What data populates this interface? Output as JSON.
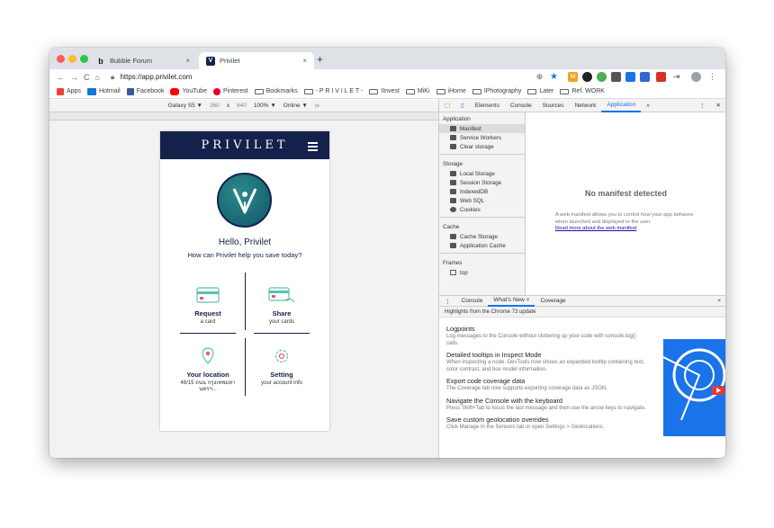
{
  "browser": {
    "tabs": [
      {
        "title": "Bubble Forum",
        "favicon": "bubble-b",
        "active": false
      },
      {
        "title": "Privilet",
        "favicon": "V",
        "active": true
      }
    ],
    "new_tab": "+",
    "close": "×",
    "url": "https://app.privilet.com",
    "nav_icons": [
      "back-arrow-icon",
      "forward-arrow-icon",
      "reload-icon",
      "home-icon"
    ]
  },
  "bookmarks": [
    {
      "label": "Apps",
      "icon": "apps-grid",
      "color": "#ea4335"
    },
    {
      "label": "Hotmail",
      "icon": "outlook",
      "color": "#0f78d4"
    },
    {
      "label": "Facebook",
      "icon": "facebook",
      "color": "#3b5998"
    },
    {
      "label": "YouTube",
      "icon": "youtube",
      "color": "#ff0000"
    },
    {
      "label": "Pinterest",
      "icon": "pinterest",
      "color": "#e60023"
    },
    {
      "label": "Bookmarks",
      "icon": "folder"
    },
    {
      "label": "- P R I V I L E T -",
      "icon": "folder"
    },
    {
      "label": "IInvest",
      "icon": "folder"
    },
    {
      "label": "MiKi",
      "icon": "folder"
    },
    {
      "label": "iHome",
      "icon": "folder"
    },
    {
      "label": "IPhotography",
      "icon": "folder"
    },
    {
      "label": "Later",
      "icon": "folder"
    },
    {
      "label": "Ref. WORK",
      "icon": "folder"
    }
  ],
  "device_toolbar": {
    "device": "Galaxy S5 ▼",
    "width": "360",
    "times": "x",
    "height": "640",
    "zoom": "100% ▼",
    "network": "Online ▼"
  },
  "app": {
    "brand": "PRIVILET",
    "greeting": "Hello, Privilet",
    "question": "How can Privilet help you save today?",
    "cards": [
      {
        "label": "Request",
        "desc": "a card"
      },
      {
        "label": "Share",
        "desc": "your cards"
      },
      {
        "label": "Your location",
        "desc": "48/15 ถนน กรุงเทพมหานครฯ..."
      },
      {
        "label": "Setting",
        "desc": "your account info"
      }
    ],
    "colors": {
      "navy": "#14214b",
      "teal": "#2a8a8c",
      "coral": "#e8605a",
      "mint": "#59c3b0"
    }
  },
  "devtools": {
    "tabs": [
      "Elements",
      "Console",
      "Sources",
      "Network",
      "Application",
      "»"
    ],
    "active_tab": "Application",
    "sidebar": {
      "application_title": "Application",
      "application_items": [
        "Manifest",
        "Service Workers",
        "Clear storage"
      ],
      "storage_title": "Storage",
      "storage_items": [
        "Local Storage",
        "Session Storage",
        "IndexedDB",
        "Web SQL",
        "Cookies"
      ],
      "cache_title": "Cache",
      "cache_items": [
        "Cache Storage",
        "Application Cache"
      ],
      "frames_title": "Frames",
      "frames_items": [
        "top"
      ]
    },
    "manifest": {
      "title": "No manifest detected",
      "description": "A web manifest allows you to control how your app behaves when launched and displayed to the user.",
      "link": "Read more about the web manifest"
    },
    "drawer": {
      "tabs": [
        "Console",
        "What's New ×",
        "Coverage"
      ],
      "active": "What's New ×",
      "close": "×",
      "highlights": "Highlights from the Chrome 73 update",
      "items": [
        {
          "title": "Logpoints",
          "text": "Log messages to the Console without cluttering up your code with console.log() calls."
        },
        {
          "title": "Detailed tooltips in Inspect Mode",
          "text": "When inspecting a node, DevTools now shows an expanded tooltip containing text, color contrast, and box model information."
        },
        {
          "title": "Export code coverage data",
          "text": "The Coverage tab now supports exporting coverage data as JSON."
        },
        {
          "title": "Navigate the Console with the keyboard",
          "text": "Press Shift+Tab to focus the last message and then use the arrow keys to navigate."
        },
        {
          "title": "Save custom geolocation overrides",
          "text": "Click Manage in the Sensors tab or open Settings > Geolocations."
        }
      ]
    }
  }
}
